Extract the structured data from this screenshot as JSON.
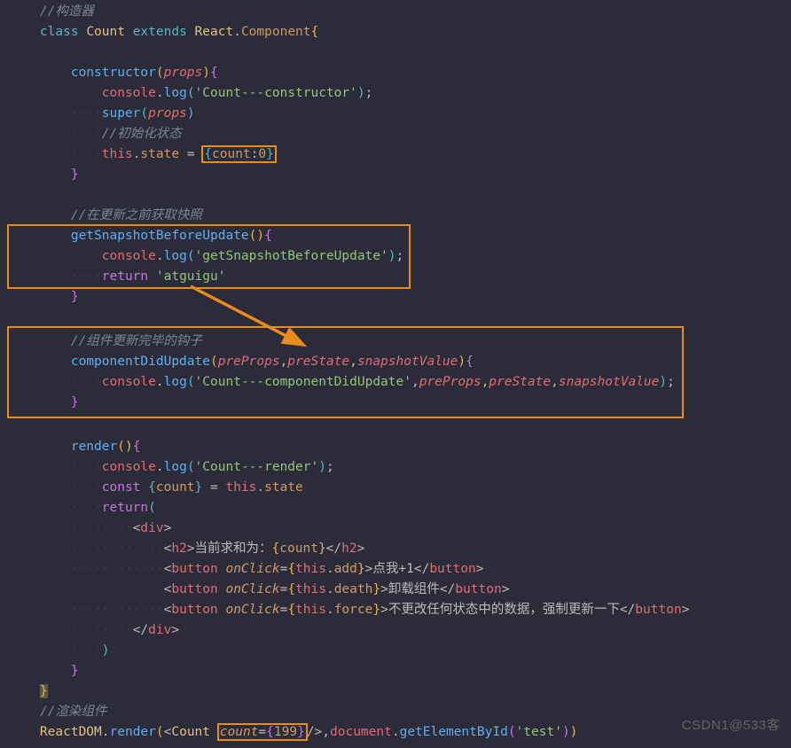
{
  "code": {
    "topComment": "//构造器",
    "l1": {
      "class": "class",
      "name": "Count",
      "extends": "extends",
      "react": "React",
      "component": "Component"
    },
    "ctor": {
      "name": "constructor",
      "props": "props",
      "log": "console",
      "logfn": "log",
      "msg": "'Count---constructor'",
      "super": "super",
      "superArg": "props",
      "cInit": "//初始化状态",
      "this": "this",
      "state": "state",
      "obj": "{count:0}",
      "countKey": "count",
      "zero": "0"
    },
    "snap": {
      "c": "//在更新之前获取快照",
      "name": "getSnapshotBeforeUpdate",
      "log": "console",
      "logfn": "log",
      "msg": "'getSnapshotBeforeUpdate'",
      "ret": "return",
      "val": "'atguigu'"
    },
    "didUpdate": {
      "c": "//组件更新完毕的钩子",
      "name": "componentDidUpdate",
      "p1": "preProps",
      "p2": "preState",
      "p3": "snapshotValue",
      "log": "console",
      "logfn": "log",
      "msg": "'Count---componentDidUpdate'"
    },
    "render": {
      "name": "render",
      "log": "console",
      "logfn": "log",
      "msg": "'Count---render'",
      "const": "const",
      "count": "count",
      "this": "this",
      "state": "state",
      "ret": "return",
      "h2text1": "当前求和为：",
      "btn1": "点我+1",
      "btn1fn": "add",
      "btn2": "卸载组件",
      "btn2fn": "death",
      "btn3": "不更改任何状态中的数据，强制更新一下",
      "btn3fn": "force",
      "onClick": "onClick",
      "this2": "this"
    },
    "bottom": {
      "c": "//渲染组件",
      "ReactDOM": "ReactDOM",
      "renderfn": "render",
      "Count": "Count",
      "countAttr": "count",
      "countVal": "199",
      "document": "document",
      "getEl": "getElementById",
      "test": "'test'"
    }
  },
  "watermark": "CSDN1@533客"
}
